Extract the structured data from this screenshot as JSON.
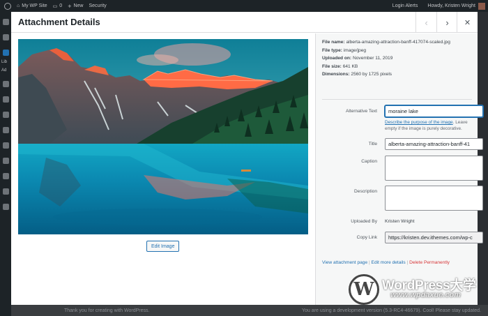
{
  "admin_bar": {
    "site_name": "My WP Site",
    "comments_count": "0",
    "new_label": "New",
    "security_label": "Security",
    "login_alerts": "Login Alerts",
    "greeting": "Howdy, Kristen Wright"
  },
  "sidebar": {
    "partial_labels": [
      "Lib",
      "Ad"
    ]
  },
  "footer": {
    "thanks": "Thank you for creating with WordPress.",
    "version_note": "You are using a development version (5.3-RC4-46679). Cool! Please stay updated."
  },
  "modal": {
    "title": "Attachment Details",
    "prev_icon": "chevron-left-icon",
    "next_icon": "chevron-right-icon",
    "close_icon": "close-icon"
  },
  "preview": {
    "image_alt": "moraine lake",
    "edit_button": "Edit Image"
  },
  "details": {
    "file_name_label": "File name:",
    "file_name": "alberta-amazing-attraction-banff-417074-scaled.jpg",
    "file_type_label": "File type:",
    "file_type": "image/jpeg",
    "uploaded_on_label": "Uploaded on:",
    "uploaded_on": "November 11, 2019",
    "file_size_label": "File size:",
    "file_size": "641 KB",
    "dimensions_label": "Dimensions:",
    "dimensions": "2560 by 1725 pixels",
    "alt_text_label": "Alternative Text",
    "alt_text_value": "moraine lake",
    "alt_help_link": "Describe the purpose of the image",
    "alt_help_rest": ". Leave empty if the image is purely decorative.",
    "title_label": "Title",
    "title_value": "alberta-amazing-attraction-banff-41",
    "caption_label": "Caption",
    "description_label": "Description",
    "uploaded_by_label": "Uploaded By",
    "uploaded_by_value": "Kristen Wright",
    "copy_link_label": "Copy Link",
    "copy_link_value": "https://kristen.dev.ithemes.com/wp-c",
    "view_attachment_link": "View attachment page",
    "edit_details_link": "Edit more details",
    "delete_link": "Delete Permanently",
    "separator": "|"
  },
  "watermark": {
    "brand": "WordPress大学",
    "url": "www.wpdaxue.com",
    "logo_letter": "W"
  },
  "colors": {
    "accent": "#2271b1",
    "danger": "#d63638",
    "admin_bar": "#1d2327"
  }
}
